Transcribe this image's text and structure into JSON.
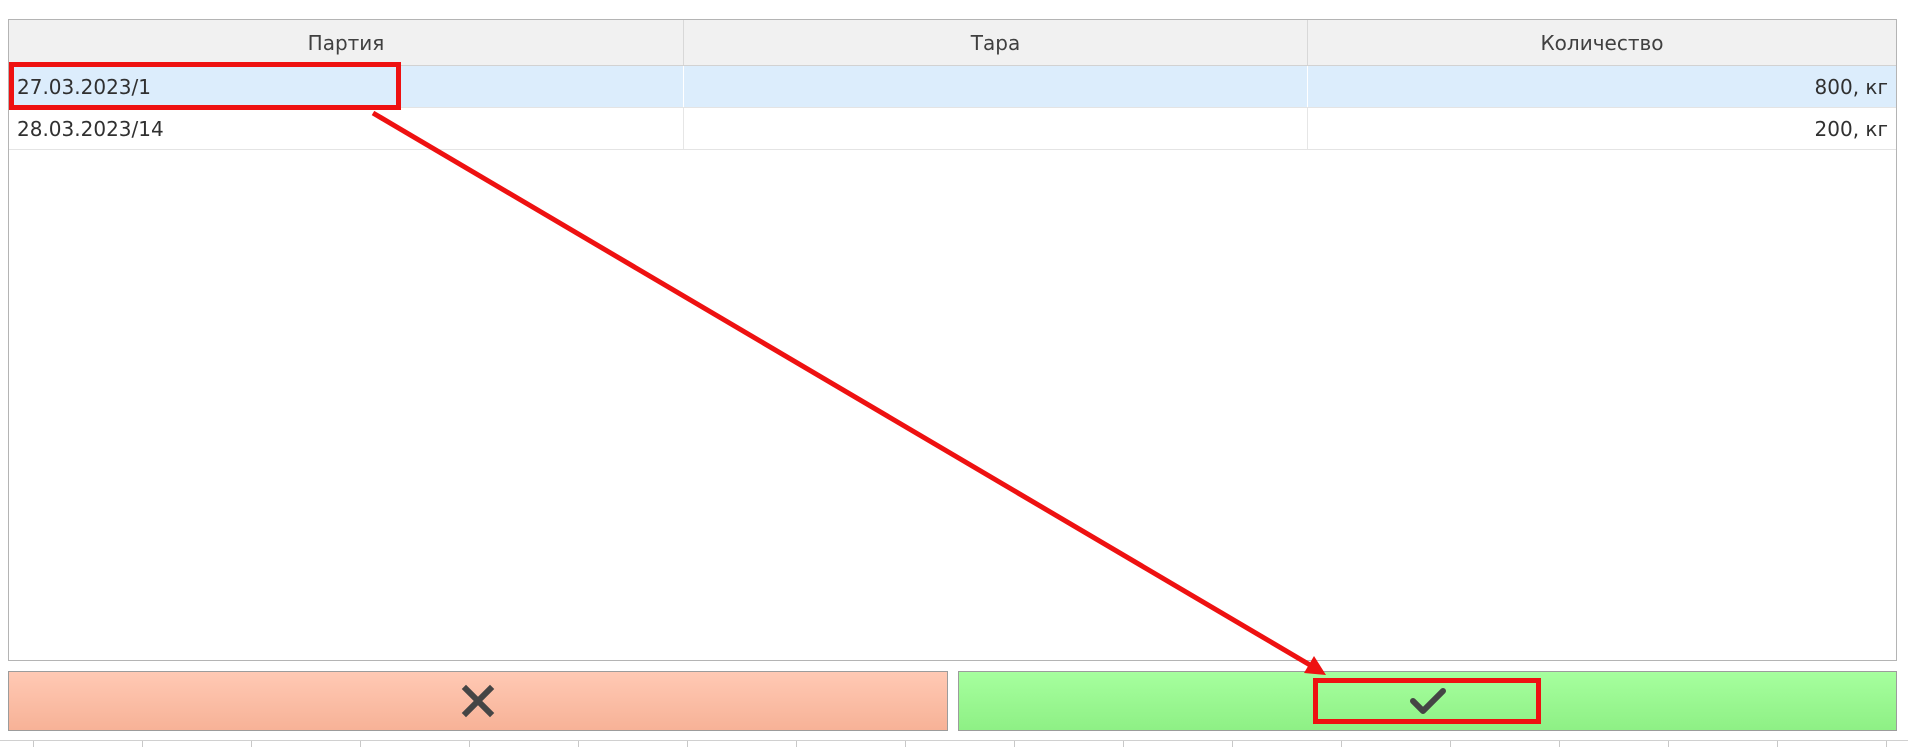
{
  "table": {
    "headers": [
      "Партия",
      "Тара",
      "Количество"
    ],
    "rows": [
      {
        "batch": "27.03.2023/1",
        "tare": "",
        "quantity": "800, кг",
        "selected": true
      },
      {
        "batch": "28.03.2023/14",
        "tare": "",
        "quantity": "200, кг",
        "selected": false
      }
    ]
  },
  "buttons": {
    "cancel_icon": "close-icon",
    "confirm_icon": "checkmark-icon"
  },
  "colors": {
    "selected_row": "#dcedfc",
    "cancel_button": "#f7b297",
    "confirm_button": "#8ef085",
    "annotation": "#ee1111"
  }
}
